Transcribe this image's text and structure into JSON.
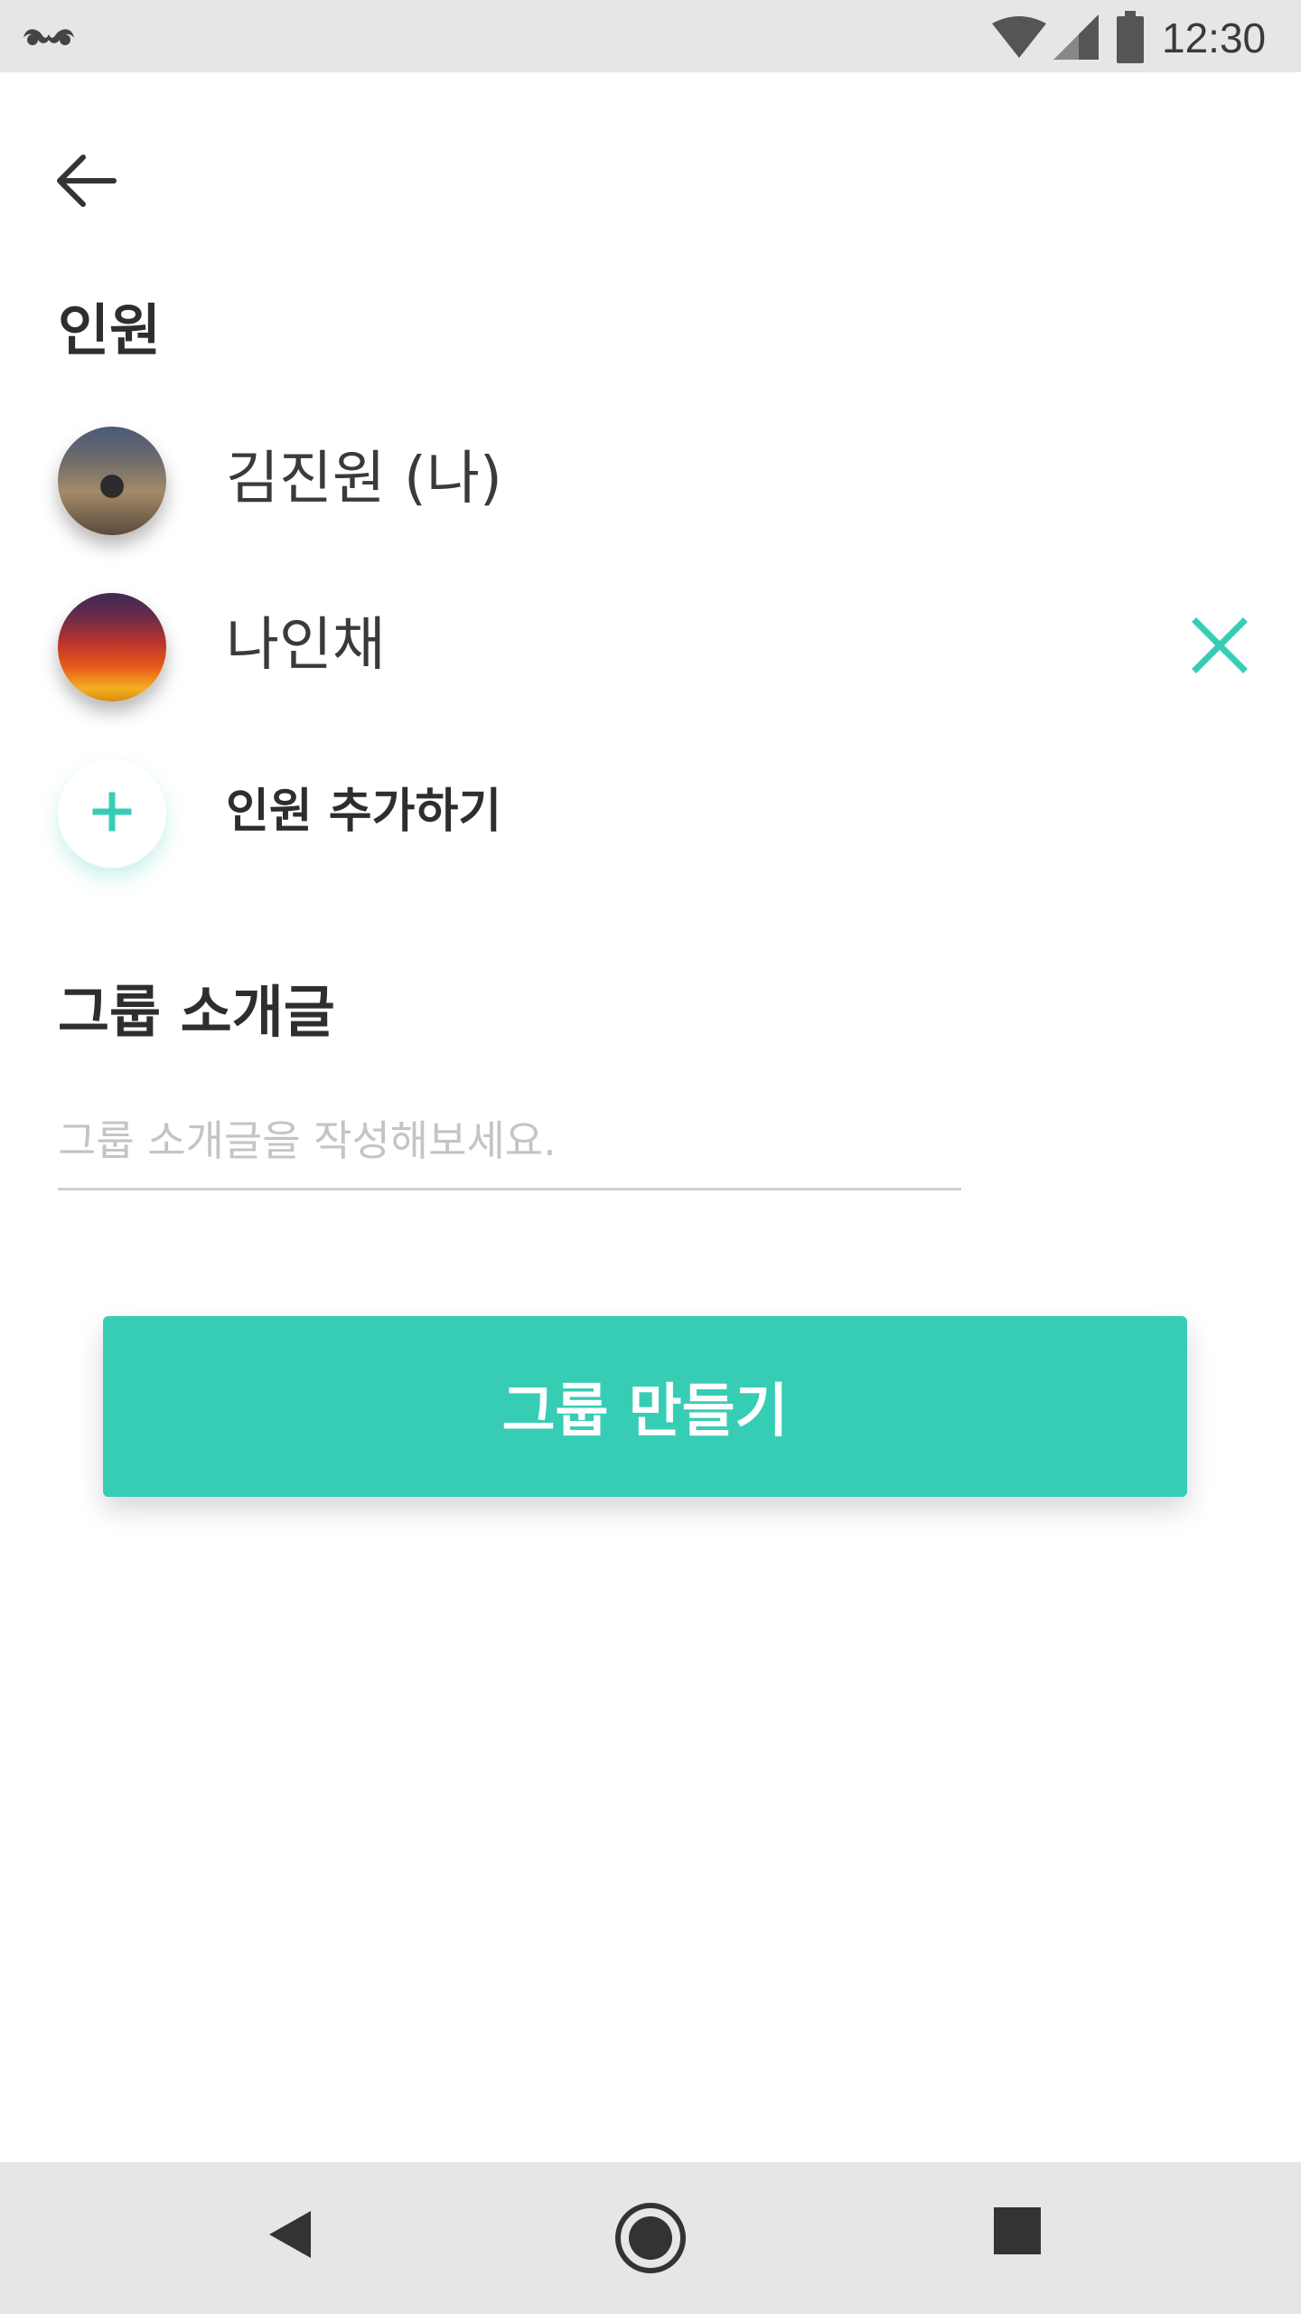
{
  "status_bar": {
    "time": "12:30"
  },
  "icons": {
    "status": [
      "mustache-icon",
      "wifi-icon",
      "cell-signal-icon",
      "battery-icon"
    ],
    "back": "arrow-left-icon",
    "remove": "close-icon",
    "add": "plus-icon",
    "nav": [
      "nav-back-icon",
      "nav-home-icon",
      "nav-recent-icon"
    ]
  },
  "colors": {
    "accent": "#37cdb5",
    "text": "#2e2e2e",
    "bars": "#e6e6e6"
  },
  "members": {
    "title": "인원",
    "list": [
      {
        "name": "김진원 (나)"
      },
      {
        "name": "나인채"
      }
    ],
    "add_label": "인원 추가하기"
  },
  "intro": {
    "title": "그룹 소개글",
    "placeholder": "그룹 소개글을 작성해보세요.",
    "value": ""
  },
  "create_button": {
    "label": "그룹 만들기"
  }
}
